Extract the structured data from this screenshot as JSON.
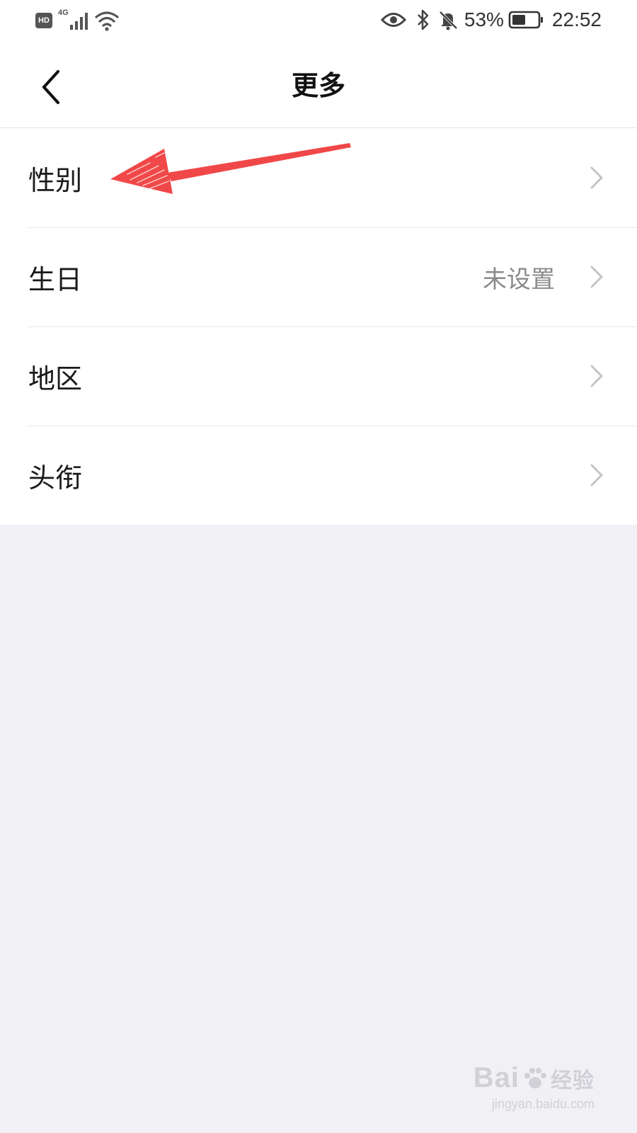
{
  "status_bar": {
    "hd": "HD",
    "network": "4G",
    "battery_percent": "53%",
    "battery_level": 0.53,
    "time": "22:52",
    "icons": [
      "hd-icon",
      "signal-icon",
      "wifi-icon",
      "eye-icon",
      "bluetooth-icon",
      "bell-off-icon",
      "battery-icon"
    ]
  },
  "nav": {
    "title": "更多",
    "back_icon": "chevron-left-icon"
  },
  "list": {
    "items": [
      {
        "label": "性别",
        "value": ""
      },
      {
        "label": "生日",
        "value": "未设置"
      },
      {
        "label": "地区",
        "value": ""
      },
      {
        "label": "头衔",
        "value": ""
      }
    ]
  },
  "colors": {
    "background": "#f0f0f5",
    "surface": "#ffffff",
    "annotation": "#f04848",
    "muted_text": "#8a8a8a",
    "chevron": "#c4c4c4"
  },
  "watermark": {
    "brand": "Bai",
    "brand_suffix": "经验",
    "url": "jingyan.baidu.com"
  }
}
